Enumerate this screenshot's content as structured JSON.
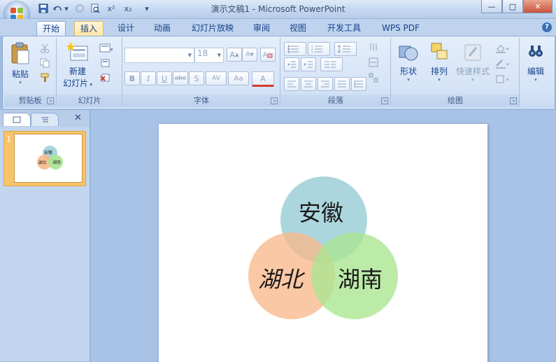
{
  "window": {
    "title": "演示文稿1 - Microsoft PowerPoint",
    "minimize_glyph": "—",
    "maximize_glyph": "□",
    "close_glyph": "✕"
  },
  "qat": {
    "undo_dropdown_glyph": "▾",
    "superscript_label": "x²",
    "subscript_label": "x₂",
    "customize_glyph": "▾"
  },
  "tabs": [
    {
      "label": "开始",
      "state": "active"
    },
    {
      "label": "插入",
      "state": "hover"
    },
    {
      "label": "设计"
    },
    {
      "label": "动画"
    },
    {
      "label": "幻灯片放映"
    },
    {
      "label": "审阅"
    },
    {
      "label": "视图"
    },
    {
      "label": "开发工具"
    },
    {
      "label": "WPS PDF"
    }
  ],
  "help_glyph": "?",
  "ribbon": {
    "clipboard": {
      "group_label": "剪贴板",
      "paste_label": "粘贴"
    },
    "slides": {
      "group_label": "幻灯片",
      "new_slide_line1": "新建",
      "new_slide_line2": "幻灯片"
    },
    "font": {
      "group_label": "字体",
      "font_name": "",
      "font_size": "18",
      "bold": "B",
      "italic": "I",
      "underline": "U",
      "strike": "abe",
      "shadow": "S",
      "spacing": "AV",
      "case": "Aa",
      "font_color": "A",
      "grow": "A",
      "shrink": "A"
    },
    "paragraph": {
      "group_label": "段落"
    },
    "drawing": {
      "group_label": "绘图",
      "shapes_label": "形状",
      "arrange_label": "排列",
      "quick_styles_label": "快速样式"
    },
    "editing": {
      "label": "编辑"
    }
  },
  "panel": {
    "close_glyph": "✕",
    "slide_number": "1"
  },
  "slide": {
    "circles": [
      {
        "label": "安徽",
        "color": "#9ecfd8",
        "italic": false
      },
      {
        "label": "湖北",
        "color": "#f8b98a",
        "italic": true
      },
      {
        "label": "湖南",
        "color": "#a9e58f",
        "italic": false
      }
    ]
  },
  "colors": {
    "ribbon_text": "#15428b",
    "accent_selection": "#f7c46b"
  }
}
